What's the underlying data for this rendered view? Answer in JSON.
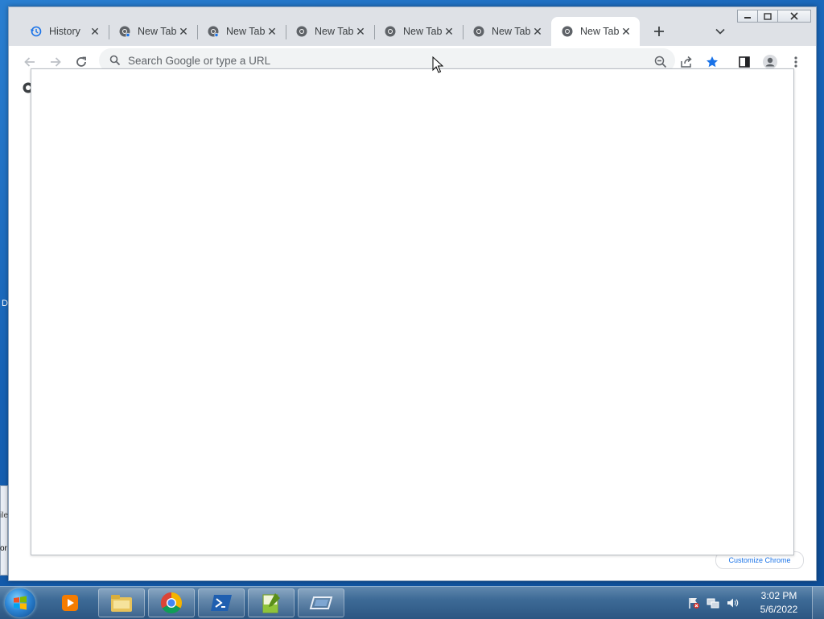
{
  "browser": {
    "tabs": [
      {
        "label": "History",
        "icon": "history-icon",
        "active": false
      },
      {
        "label": "New Tab",
        "icon": "chrome-icon",
        "active": false
      },
      {
        "label": "New Tab",
        "icon": "chrome-icon",
        "active": false
      },
      {
        "label": "New Tab",
        "icon": "chrome-icon",
        "active": false
      },
      {
        "label": "New Tab",
        "icon": "chrome-icon",
        "active": false
      },
      {
        "label": "New Tab",
        "icon": "chrome-icon",
        "active": false
      },
      {
        "label": "New Tab",
        "icon": "chrome-icon",
        "active": true
      }
    ],
    "omnibox": {
      "placeholder": "Search Google or type a URL",
      "value": ""
    },
    "customize_label": "Customize Chrome",
    "accent_color": "#1a73e8"
  },
  "taskbar": {
    "clock_time": "3:02 PM",
    "clock_date": "5/6/2022",
    "items": [
      "media-player-icon",
      "file-explorer-icon",
      "chrome-icon",
      "powershell-icon",
      "notepad-plus-icon",
      "remote-app-icon"
    ]
  },
  "desktop": {
    "partial_labels": [
      "D",
      "ile",
      "or"
    ]
  }
}
